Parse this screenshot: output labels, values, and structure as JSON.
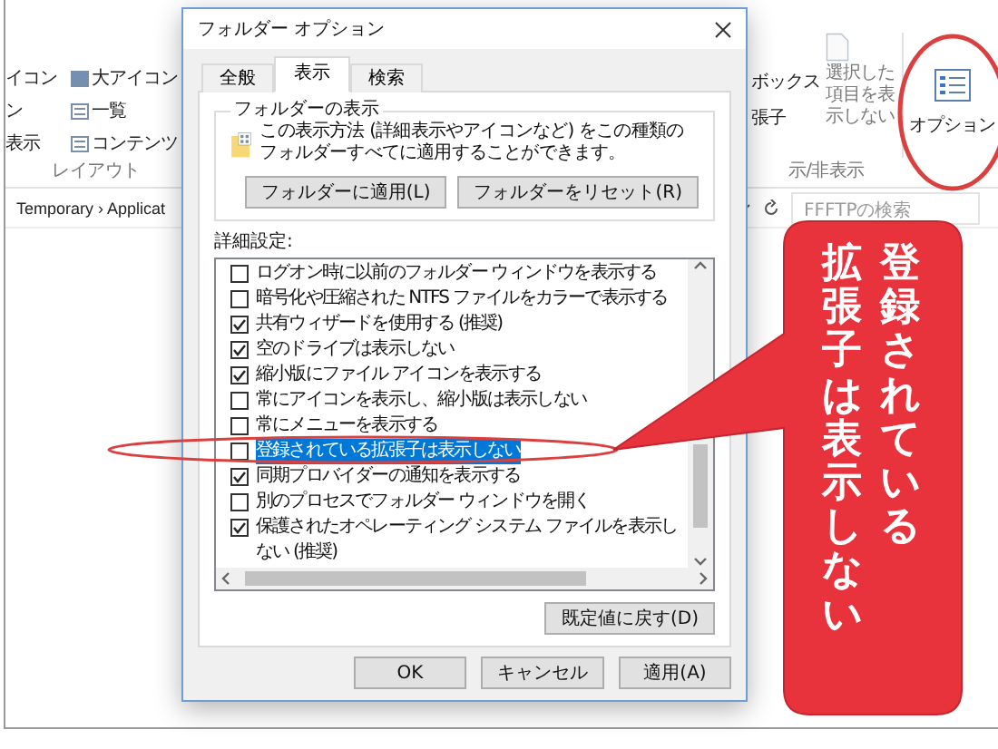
{
  "explorer": {
    "view_options": [
      {
        "partial": "イコン",
        "label": "大アイコン"
      },
      {
        "partial": "ン",
        "label": "一覧"
      },
      {
        "partial": "表示",
        "label": "コンテンツ"
      }
    ],
    "layout_group": "レイアウト",
    "show_hide_items": [
      "ボックス",
      "張子"
    ],
    "hide_selected": "選択した項目を表示しない",
    "options_button": "オプション",
    "show_hide_group": "示/非表示",
    "breadcrumb": "Temporary › Applicat",
    "search_placeholder": "FFFTPの検索"
  },
  "dialog": {
    "title": "フォルダー オプション",
    "tabs": [
      {
        "label": "全般",
        "selected": false
      },
      {
        "label": "表示",
        "selected": true
      },
      {
        "label": "検索",
        "selected": false
      }
    ],
    "folder_views": {
      "title": "フォルダーの表示",
      "description": "この表示方法 (詳細表示やアイコンなど) をこの種類のフォルダーすべてに適用することができます。",
      "buttons": [
        "フォルダーに適用(L)",
        "フォルダーをリセット(R)"
      ]
    },
    "advanced_label": "詳細設定:",
    "settings": [
      {
        "label": "ログオン時に以前のフォルダー ウィンドウを表示する",
        "checked": false,
        "selected": false
      },
      {
        "label": "暗号化や圧縮された NTFS ファイルをカラーで表示する",
        "checked": false,
        "selected": false
      },
      {
        "label": "共有ウィザードを使用する (推奨)",
        "checked": true,
        "selected": false
      },
      {
        "label": "空のドライブは表示しない",
        "checked": true,
        "selected": false
      },
      {
        "label": "縮小版にファイル アイコンを表示する",
        "checked": true,
        "selected": false
      },
      {
        "label": "常にアイコンを表示し、縮小版は表示しない",
        "checked": false,
        "selected": false
      },
      {
        "label": "常にメニューを表示する",
        "checked": false,
        "selected": false
      },
      {
        "label": "登録されている拡張子は表示しない",
        "checked": false,
        "selected": true
      },
      {
        "label": "同期プロバイダーの通知を表示する",
        "checked": true,
        "selected": false
      },
      {
        "label": "別のプロセスでフォルダー ウィンドウを開く",
        "checked": false,
        "selected": false
      },
      {
        "label": "保護されたオペレーティング システム ファイルを表示しない (推奨)",
        "checked": true,
        "selected": false
      }
    ],
    "reset_button": "既定値に戻す(D)",
    "buttons": [
      "OK",
      "キャンセル",
      "適用(A)"
    ]
  },
  "callout": {
    "text": "登録されている拡張子は表示しない"
  }
}
